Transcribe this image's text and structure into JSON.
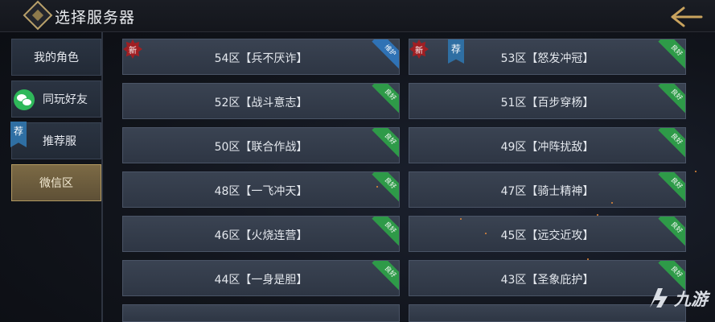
{
  "header": {
    "title": "选择服务器"
  },
  "sidebar": {
    "tabs": [
      {
        "label": "我的角色",
        "active": false,
        "icon": null
      },
      {
        "label": "同玩好友",
        "active": false,
        "icon": "wechat-icon"
      },
      {
        "label": "推荐服",
        "active": false,
        "icon": "recommend-ribbon",
        "ribbon_text": "荐"
      },
      {
        "label": "微信区",
        "active": true,
        "icon": null
      }
    ]
  },
  "servers": [
    {
      "label": "54区【兵不厌诈】",
      "status": "维护",
      "status_color": "#2f72b5",
      "new": true,
      "new_text": "新",
      "recommended": false
    },
    {
      "label": "53区【怒发冲冠】",
      "status": "良好",
      "status_color": "#2e9a48",
      "new": true,
      "new_text": "新",
      "recommended": true,
      "rec_text": "荐"
    },
    {
      "label": "52区【战斗意志】",
      "status": "良好",
      "status_color": "#2e9a48",
      "new": false,
      "recommended": false
    },
    {
      "label": "51区【百步穿杨】",
      "status": "良好",
      "status_color": "#2e9a48",
      "new": false,
      "recommended": false
    },
    {
      "label": "50区【联合作战】",
      "status": "良好",
      "status_color": "#2e9a48",
      "new": false,
      "recommended": false
    },
    {
      "label": "49区【冲阵扰敌】",
      "status": "良好",
      "status_color": "#2e9a48",
      "new": false,
      "recommended": false
    },
    {
      "label": "48区【一飞冲天】",
      "status": "良好",
      "status_color": "#2e9a48",
      "new": false,
      "recommended": false
    },
    {
      "label": "47区【骑士精神】",
      "status": "良好",
      "status_color": "#2e9a48",
      "new": false,
      "recommended": false
    },
    {
      "label": "46区【火烧连营】",
      "status": "良好",
      "status_color": "#2e9a48",
      "new": false,
      "recommended": false
    },
    {
      "label": "45区【远交近攻】",
      "status": "良好",
      "status_color": "#2e9a48",
      "new": false,
      "recommended": false
    },
    {
      "label": "44区【一身是胆】",
      "status": "良好",
      "status_color": "#2e9a48",
      "new": false,
      "recommended": false
    },
    {
      "label": "43区【圣象庇护】",
      "status": "良好",
      "status_color": "#2e9a48",
      "new": false,
      "recommended": false
    }
  ],
  "watermark": {
    "text": "九游"
  },
  "colors": {
    "accent_gold": "#b39a62",
    "good": "#2e9a48",
    "maintenance": "#2f72b5",
    "new": "#a01f23"
  }
}
